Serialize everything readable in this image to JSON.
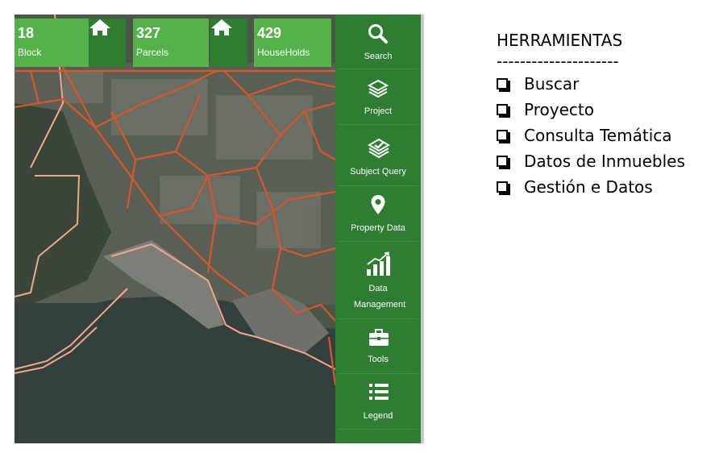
{
  "stats": [
    {
      "value": "18",
      "label": "Block"
    },
    {
      "value": "327",
      "label": "Parcels"
    },
    {
      "value": "429",
      "label": "HouseHolds"
    }
  ],
  "sidebar": {
    "items": [
      {
        "label": "Search",
        "icon": "search-icon"
      },
      {
        "label": "Project",
        "icon": "layers-icon"
      },
      {
        "label": "Subject Query",
        "icon": "layers-check-icon"
      },
      {
        "label": "Property Data",
        "icon": "map-pin-icon"
      },
      {
        "label": "Data Management",
        "icon": "bar-chart-icon"
      },
      {
        "label": "Tools",
        "icon": "toolbox-icon"
      },
      {
        "label": "Legend",
        "icon": "list-icon"
      }
    ]
  },
  "panel": {
    "title": "HERRAMIENTAS",
    "divider": "---------------------",
    "items": [
      "Buscar",
      "Proyecto",
      "Consulta Temática",
      "Datos de Inmuebles",
      "Gestión e Datos"
    ]
  },
  "colors": {
    "sidebar_green": "#2e7d32",
    "stat_green": "#55b24a",
    "boundary_orange": "#d9552a",
    "shoreline_pink": "#f3a58b"
  }
}
